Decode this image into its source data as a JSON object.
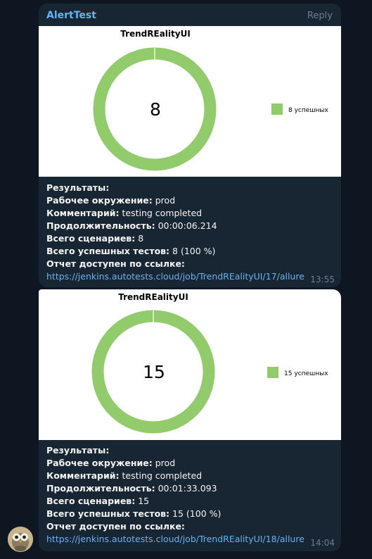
{
  "colors": {
    "bg": "#0e1621",
    "bubble": "#182533",
    "accent": "#64b5ef",
    "link": "#6ab2f2",
    "chart_green": "#91cb6b"
  },
  "messages": [
    {
      "sender": "AlertTest",
      "reply_label": "Reply",
      "chart_data": {
        "type": "pie",
        "title": "TrendREalityUI",
        "center_label": "8",
        "categories": [
          "8 успешных"
        ],
        "values": [
          8
        ],
        "colors": [
          "#91cb6b"
        ],
        "legend": "right"
      },
      "results_label": "Результаты:",
      "env_label": "Рабочее окружение:",
      "env_value": "prod",
      "comment_label": "Комментарий:",
      "comment_value": "testing completed",
      "duration_label": "Продолжительность:",
      "duration_value": "00:00:06.214",
      "scenarios_label": "Всего сценариев:",
      "scenarios_value": "8",
      "passed_label": "Всего успешных тестов:",
      "passed_value": "8 (100 %)",
      "report_label": "Отчет доступен по ссылке:",
      "report_link": "https://jenkins.autotests.cloud/job/TrendREalityUI/17/allure",
      "time": "13:55"
    },
    {
      "chart_data": {
        "type": "pie",
        "title": "TrendREalityUI",
        "center_label": "15",
        "categories": [
          "15 успешных"
        ],
        "values": [
          15
        ],
        "colors": [
          "#91cb6b"
        ],
        "legend": "right"
      },
      "results_label": "Результаты:",
      "env_label": "Рабочее окружение:",
      "env_value": "prod",
      "comment_label": "Комментарий:",
      "comment_value": "testing completed",
      "duration_label": "Продолжительность:",
      "duration_value": "00:01:33.093",
      "scenarios_label": "Всего сценариев:",
      "scenarios_value": "15",
      "passed_label": "Всего успешных тестов:",
      "passed_value": "15 (100 %)",
      "report_label": "Отчет доступен по ссылке:",
      "report_link": "https://jenkins.autotests.cloud/job/TrendREalityUI/18/allure",
      "time": "14:04"
    }
  ]
}
